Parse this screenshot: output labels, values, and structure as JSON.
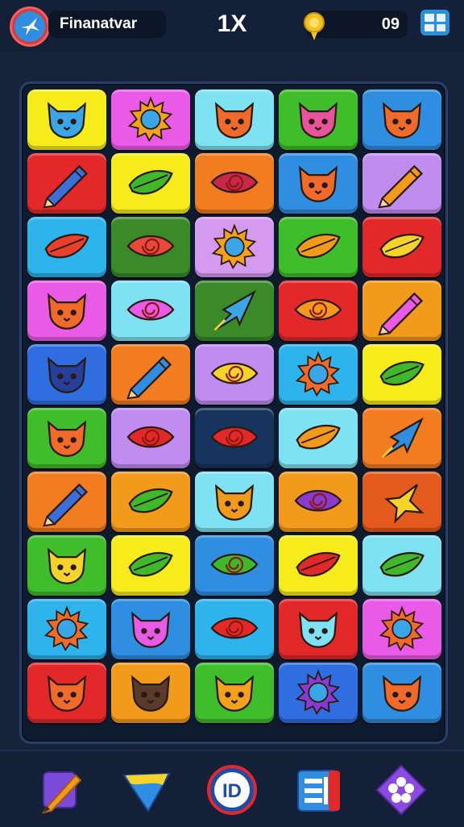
{
  "header": {
    "player_name": "Finanatvar",
    "multiplier": "1X",
    "coin_count": "09",
    "colors": {
      "bar": "#132038",
      "pill": "#0c1626",
      "menu": "#2b8fe0"
    }
  },
  "board": {
    "rows": 10,
    "cols": 5,
    "tiles": [
      [
        {
          "color": "#f6ec1c",
          "icon": "cat-icon",
          "fg": "#3aa6e8"
        },
        {
          "color": "#e95be6",
          "icon": "sun-icon",
          "fg": "#f4a21c"
        },
        {
          "color": "#7fe2f3",
          "icon": "cat-icon",
          "fg": "#f06a2a"
        },
        {
          "color": "#3fbd2b",
          "icon": "cat-icon",
          "fg": "#e8539a"
        },
        {
          "color": "#2f8ee0",
          "icon": "cat-icon",
          "fg": "#f06a2a"
        }
      ],
      [
        {
          "color": "#e3282a",
          "icon": "pencil-icon",
          "fg": "#3a6ed8"
        },
        {
          "color": "#f6ec1c",
          "icon": "leaf-icon",
          "fg": "#3fb82b"
        },
        {
          "color": "#f17d20",
          "icon": "eye-icon",
          "fg": "#c8284a"
        },
        {
          "color": "#2f8ee0",
          "icon": "cat-icon",
          "fg": "#f06a2a"
        },
        {
          "color": "#c08cf0",
          "icon": "pencil-icon",
          "fg": "#f29a1c"
        }
      ],
      [
        {
          "color": "#2fb3ec",
          "icon": "leaf-icon",
          "fg": "#e8402a"
        },
        {
          "color": "#3a8a2a",
          "icon": "eye-icon",
          "fg": "#e84a3a"
        },
        {
          "color": "#d49af0",
          "icon": "sun-icon",
          "fg": "#f4a21c"
        },
        {
          "color": "#3fbd2b",
          "icon": "leaf-icon",
          "fg": "#f29a1c"
        },
        {
          "color": "#e3282a",
          "icon": "leaf-icon",
          "fg": "#f4d42a"
        }
      ],
      [
        {
          "color": "#e95be6",
          "icon": "cat-icon",
          "fg": "#f06a2a"
        },
        {
          "color": "#7fe2f3",
          "icon": "eye-icon",
          "fg": "#e95be6"
        },
        {
          "color": "#3a8a2a",
          "icon": "arrow-icon",
          "fg": "#3aa6e8"
        },
        {
          "color": "#e3282a",
          "icon": "eye-icon",
          "fg": "#f29a1c"
        },
        {
          "color": "#f29a1c",
          "icon": "pencil-icon",
          "fg": "#e95be6"
        }
      ],
      [
        {
          "color": "#2f6ee0",
          "icon": "cat-icon",
          "fg": "#24409a"
        },
        {
          "color": "#f17d20",
          "icon": "pencil-icon",
          "fg": "#2f8ee0"
        },
        {
          "color": "#c08cf0",
          "icon": "eye-icon",
          "fg": "#f4d42a"
        },
        {
          "color": "#2fb3ec",
          "icon": "sun-icon",
          "fg": "#f06a2a"
        },
        {
          "color": "#f6ec1c",
          "icon": "leaf-icon",
          "fg": "#3fb82b"
        }
      ],
      [
        {
          "color": "#3fbd2b",
          "icon": "cat-icon",
          "fg": "#f06a2a"
        },
        {
          "color": "#c08cf0",
          "icon": "eye-icon",
          "fg": "#e3282a"
        },
        {
          "color": "#17345e",
          "icon": "eye-icon",
          "fg": "#e3282a"
        },
        {
          "color": "#7fe2f3",
          "icon": "leaf-icon",
          "fg": "#f29a1c"
        },
        {
          "color": "#f17d20",
          "icon": "arrow-icon",
          "fg": "#2f8ee0"
        }
      ],
      [
        {
          "color": "#f17d20",
          "icon": "pencil-icon",
          "fg": "#3a6ed8"
        },
        {
          "color": "#f29a1c",
          "icon": "leaf-icon",
          "fg": "#3fb82b"
        },
        {
          "color": "#7fe2f3",
          "icon": "cat-icon",
          "fg": "#f29a1c"
        },
        {
          "color": "#f29a1c",
          "icon": "eye-icon",
          "fg": "#8a3ad0"
        },
        {
          "color": "#e35a1c",
          "icon": "star-icon",
          "fg": "#f4d42a"
        }
      ],
      [
        {
          "color": "#3fbd2b",
          "icon": "cat-icon",
          "fg": "#f4d42a"
        },
        {
          "color": "#f6ec1c",
          "icon": "leaf-icon",
          "fg": "#3fb82b"
        },
        {
          "color": "#2f8ee0",
          "icon": "eye-icon",
          "fg": "#3fb82b"
        },
        {
          "color": "#f6ec1c",
          "icon": "leaf-icon",
          "fg": "#e3282a"
        },
        {
          "color": "#7fe2f3",
          "icon": "leaf-icon",
          "fg": "#3fb82b"
        }
      ],
      [
        {
          "color": "#2fb3ec",
          "icon": "sun-icon",
          "fg": "#f06a2a"
        },
        {
          "color": "#2f8ee0",
          "icon": "cat-icon",
          "fg": "#e95be6"
        },
        {
          "color": "#2fb3ec",
          "icon": "eye-icon",
          "fg": "#e3282a"
        },
        {
          "color": "#e3282a",
          "icon": "cat-icon",
          "fg": "#7fe2f3"
        },
        {
          "color": "#e95be6",
          "icon": "sun-icon",
          "fg": "#f06a2a"
        }
      ],
      [
        {
          "color": "#e3282a",
          "icon": "cat-icon",
          "fg": "#f06a2a"
        },
        {
          "color": "#f29a1c",
          "icon": "cat-icon",
          "fg": "#5a3a2a"
        },
        {
          "color": "#3fbd2b",
          "icon": "cat-icon",
          "fg": "#f4a21c"
        },
        {
          "color": "#2f6ee0",
          "icon": "sun-icon",
          "fg": "#8a3ad0"
        },
        {
          "color": "#2f8ee0",
          "icon": "cat-icon",
          "fg": "#f06a2a"
        }
      ]
    ]
  },
  "toolbar": {
    "buttons": [
      {
        "icon": "pencil-icon",
        "label": ""
      },
      {
        "icon": "arrow-down-icon",
        "label": ""
      },
      {
        "icon": "badge-icon",
        "label": "ID"
      },
      {
        "icon": "list-icon",
        "label": ""
      },
      {
        "icon": "flower-icon",
        "label": ""
      }
    ]
  }
}
